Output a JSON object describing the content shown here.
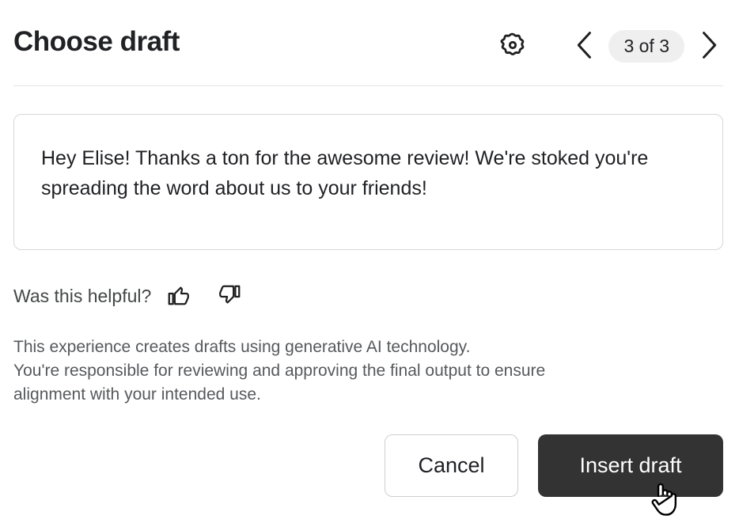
{
  "header": {
    "title": "Choose draft",
    "settings_icon": "gear-icon",
    "prev_icon": "chevron-left-icon",
    "next_icon": "chevron-right-icon",
    "page_indicator": "3 of 3",
    "pill_background": "#efefef"
  },
  "draft": {
    "text": "Hey Elise! Thanks a ton for the awesome review! We're stoked you're spreading the word about us to your friends!",
    "border_color": "#d7d7d7"
  },
  "feedback": {
    "label": "Was this helpful?",
    "thumbs_up_icon": "thumbs-up-icon",
    "thumbs_down_icon": "thumbs-down-icon"
  },
  "disclaimer": {
    "line1": "This experience creates drafts using generative AI technology.",
    "line2": "You're responsible for reviewing and approving the final output to ensure",
    "line3": "alignment with your intended use.",
    "text_color": "#56595c"
  },
  "actions": {
    "cancel_label": "Cancel",
    "insert_label": "Insert draft",
    "insert_background": "#333333",
    "insert_text_color": "#ffffff"
  },
  "cursor": {
    "type": "pointing-hand-cursor"
  }
}
